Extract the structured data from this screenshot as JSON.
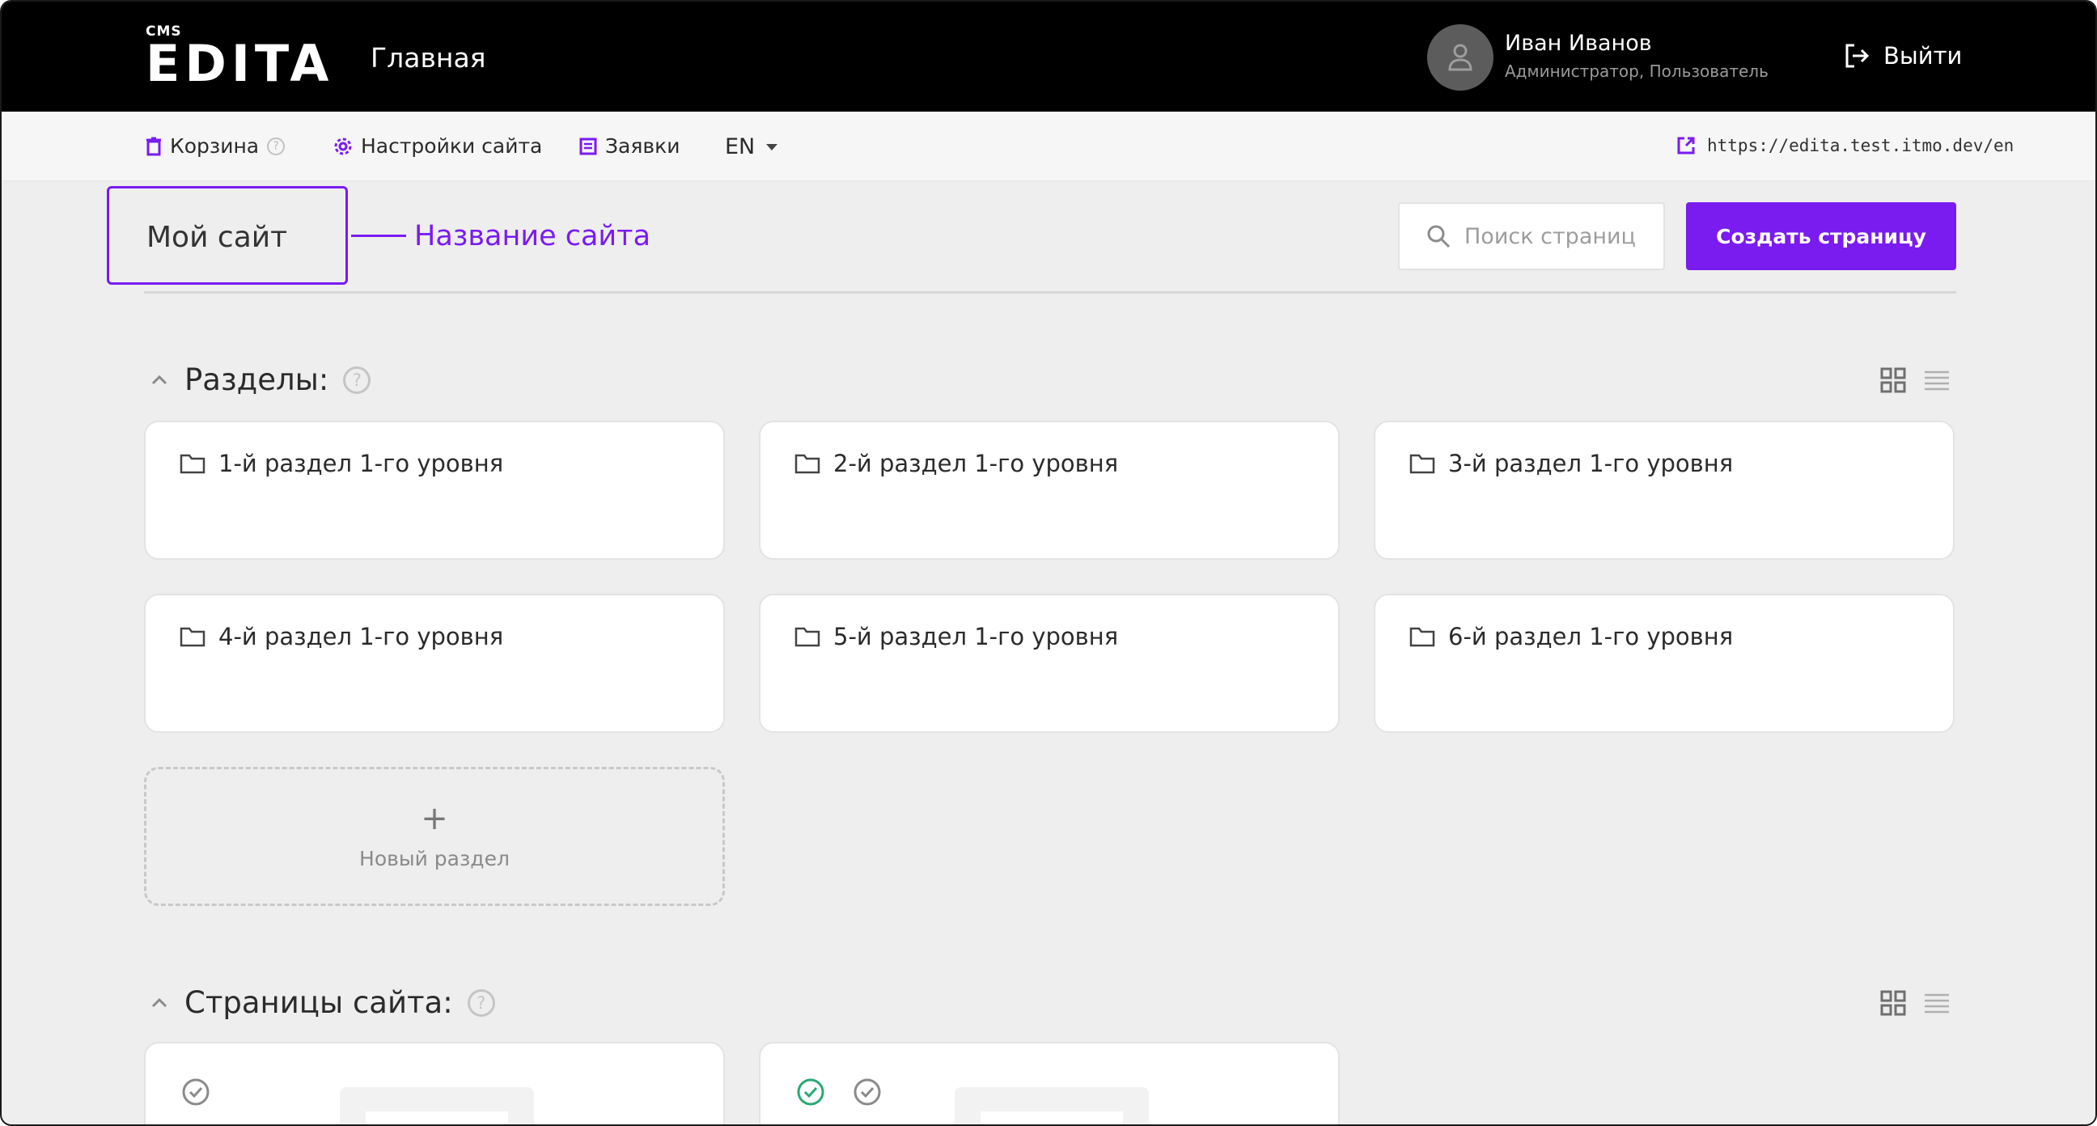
{
  "header": {
    "logo_small": "CMS",
    "logo_brand": "EDITA",
    "page_title": "Главная",
    "user": {
      "name": "Иван Иванов",
      "role": "Администратор, Пользователь"
    },
    "logout_label": "Выйти"
  },
  "subnav": {
    "trash_label": "Корзина",
    "settings_label": "Настройки сайта",
    "requests_label": "Заявки",
    "language": "EN",
    "site_url": "https://edita.test.itmo.dev/en"
  },
  "site": {
    "name": "Мой сайт",
    "callout": "Название сайта",
    "search_placeholder": "Поиск страниц",
    "create_button": "Создать страницу"
  },
  "sections": {
    "title": "Разделы:",
    "items": [
      "1-й раздел 1-го уровня",
      "2-й раздел 1-го уровня",
      "3-й раздел 1-го уровня",
      "4-й раздел 1-го уровня",
      "5-й раздел 1-го уровня",
      "6-й раздел 1-го уровня"
    ],
    "new_label": "Новый раздел"
  },
  "pages": {
    "title": "Страницы сайта:"
  },
  "colors": {
    "accent": "#7a1bf0",
    "header_bg": "#000000",
    "content_bg": "#eeeeee",
    "published_check": "#2aa873"
  }
}
